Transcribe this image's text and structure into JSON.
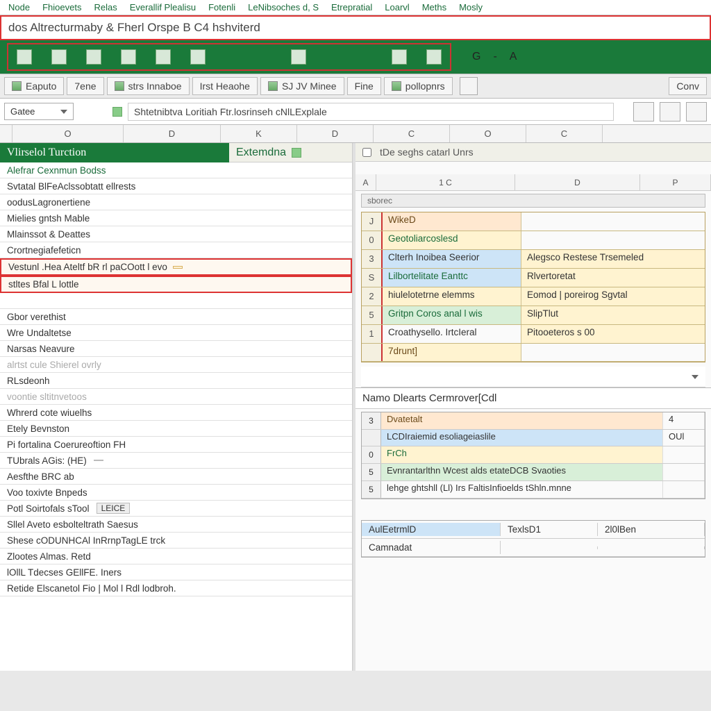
{
  "menu": [
    "Node",
    "Fhioevets",
    "Relas",
    "Everallif Plealisu",
    "Fotenli",
    "LeNibsoches d, S",
    "Etrepratial",
    "Loarvl",
    "Meths",
    "Mosly"
  ],
  "title": "dos Altrecturmaby & Fherl Orspe B C4 hshviterd",
  "tabs": [
    "Eaputo",
    "7ene",
    "strs Innaboe",
    "Irst Heaohe",
    "SJ JV Minee",
    "Fine",
    "pollopnrs",
    "Conv"
  ],
  "namebox": "Gatee",
  "ribbon_right": [
    "G",
    "-",
    "A"
  ],
  "formula": "Shtetnibtva Loritiah Ftr.losrinseh cNlLExplale",
  "cols": [
    "O",
    "D",
    "K",
    "D",
    "C",
    "O",
    "C"
  ],
  "left_header": "Vlirselol Turction",
  "mid_header": "Extemdna",
  "left_rows": [
    {
      "t": "Alefrar Cexnmun Bodss",
      "cls": "green"
    },
    {
      "t": "Svtatal BlFeAclssobtatt ellrests",
      "cls": ""
    },
    {
      "t": "oodusLagronertiene",
      "cls": ""
    },
    {
      "t": "Mielies gntsh Mable",
      "cls": ""
    },
    {
      "t": "Mlainssot & Deattes",
      "cls": ""
    },
    {
      "t": "Crortnegiafefeticn",
      "cls": ""
    },
    {
      "t": "Vestunl .Hea Ateltf bR rl paCOott l evo",
      "cls": "sel",
      "tag": true
    },
    {
      "t": "stltes Bfal L lottle",
      "cls": "sel"
    },
    {
      "t": "",
      "cls": "",
      "spacer": true
    },
    {
      "t": "Gbor verethist",
      "cls": ""
    },
    {
      "t": "Wre Undaltetse",
      "cls": ""
    },
    {
      "t": "Narsas Neavure",
      "cls": ""
    },
    {
      "t": "alrtst cule Shierel ovrly",
      "cls": "faded"
    },
    {
      "t": "RLsdeonh",
      "cls": ""
    },
    {
      "t": "voontie sltitnvetoos",
      "cls": "faded"
    },
    {
      "t": "Whrerd cote wiuelhs",
      "cls": ""
    },
    {
      "t": "Etely Bevnston",
      "cls": ""
    },
    {
      "t": "Pi fortalina Coerureoftion FH",
      "cls": ""
    },
    {
      "t": "TUbrals AGis: (HE)",
      "cls": "",
      "badge": ""
    },
    {
      "t": "Aesfthe BRC ab",
      "cls": ""
    },
    {
      "t": "Voo toxivte Bnpeds",
      "cls": ""
    },
    {
      "t": "Potl Soirtofals sTool",
      "cls": "",
      "badge": "LEICE"
    },
    {
      "t": "Sllel Aveto esbolteltrath Saesus",
      "cls": ""
    },
    {
      "t": "Shese cODUNHCAl InRrnpTagLE trck",
      "cls": ""
    },
    {
      "t": "Zlootes Almas. Retd",
      "cls": ""
    },
    {
      "t": "lOllL Tdecses GEllFE. Iners",
      "cls": ""
    },
    {
      "t": "Retide Elscanetol Fio | Mol l Rdl lodbroh.",
      "cls": ""
    }
  ],
  "right_top": "tDe seghs catarl Unrs",
  "mini_cols": [
    "A",
    "1 C",
    "D",
    "P"
  ],
  "subhdr": "sborec",
  "table1": [
    {
      "n": "J",
      "c1": "WikeD",
      "c2": "",
      "bg": "pch",
      "tc": "txt-brn"
    },
    {
      "n": "0",
      "c1": "Geotoliarcoslesd",
      "c2": "",
      "bg": "ylw",
      "tc": "txt-grn"
    },
    {
      "n": "3",
      "c1": "Clterh Inoibea Seerior",
      "c2": "Alegsco Restese Trsemeled",
      "bg": "blu",
      "tc": ""
    },
    {
      "n": "S",
      "c1": "Lilbortelitate Eanttc",
      "c2": "Rlvertoretat",
      "bg": "blu",
      "tc": "txt-grn"
    },
    {
      "n": "2",
      "c1": "hiulelotetrne elemms",
      "c2": "Eomod | poreirog Sgvtal",
      "bg": "ylw",
      "tc": ""
    },
    {
      "n": "5",
      "c1": "Gritpn Coros anal l wis",
      "c2": "SlipTlut",
      "bg": "grn",
      "tc": "txt-grn"
    },
    {
      "n": "1",
      "c1": "Croathysello. IrtcIeral",
      "c2": "Pitooeteros s 00",
      "bg": "",
      "tc": ""
    },
    {
      "n": "",
      "c1": "7drunt]",
      "c2": "",
      "bg": "ylw",
      "tc": "txt-brn"
    }
  ],
  "panel2_title": "Namo Dlearts Cermrover[Cdl",
  "table2": [
    {
      "n": "3",
      "c1": "Dvatetalt",
      "c2": "4",
      "bg": "pch",
      "tc": "txt-brn"
    },
    {
      "n": "",
      "c1": "LCDIraiemid esoliageiaslile",
      "c2": "OUl",
      "bg": "blu"
    },
    {
      "n": "0",
      "c1": "FrCh",
      "c2": "",
      "bg": "ylw",
      "tc": "txt-grn"
    },
    {
      "n": "5",
      "c1": "Evnrantarlthn Wcest alds etateDCB Svaoties",
      "c2": "",
      "bg": "grn"
    },
    {
      "n": "5",
      "c1": "lehge ghtshll (Ll) Irs FaltisInfioelds tShln.mnne",
      "c2": "",
      "bg": ""
    }
  ],
  "footer": [
    {
      "c1": "AulEetrmlD",
      "c2": "TexlsD1",
      "c3": "2l0lBen",
      "bg": "blu"
    },
    {
      "c1": "Camnadat",
      "c2": "",
      "c3": "",
      "bg": ""
    }
  ]
}
